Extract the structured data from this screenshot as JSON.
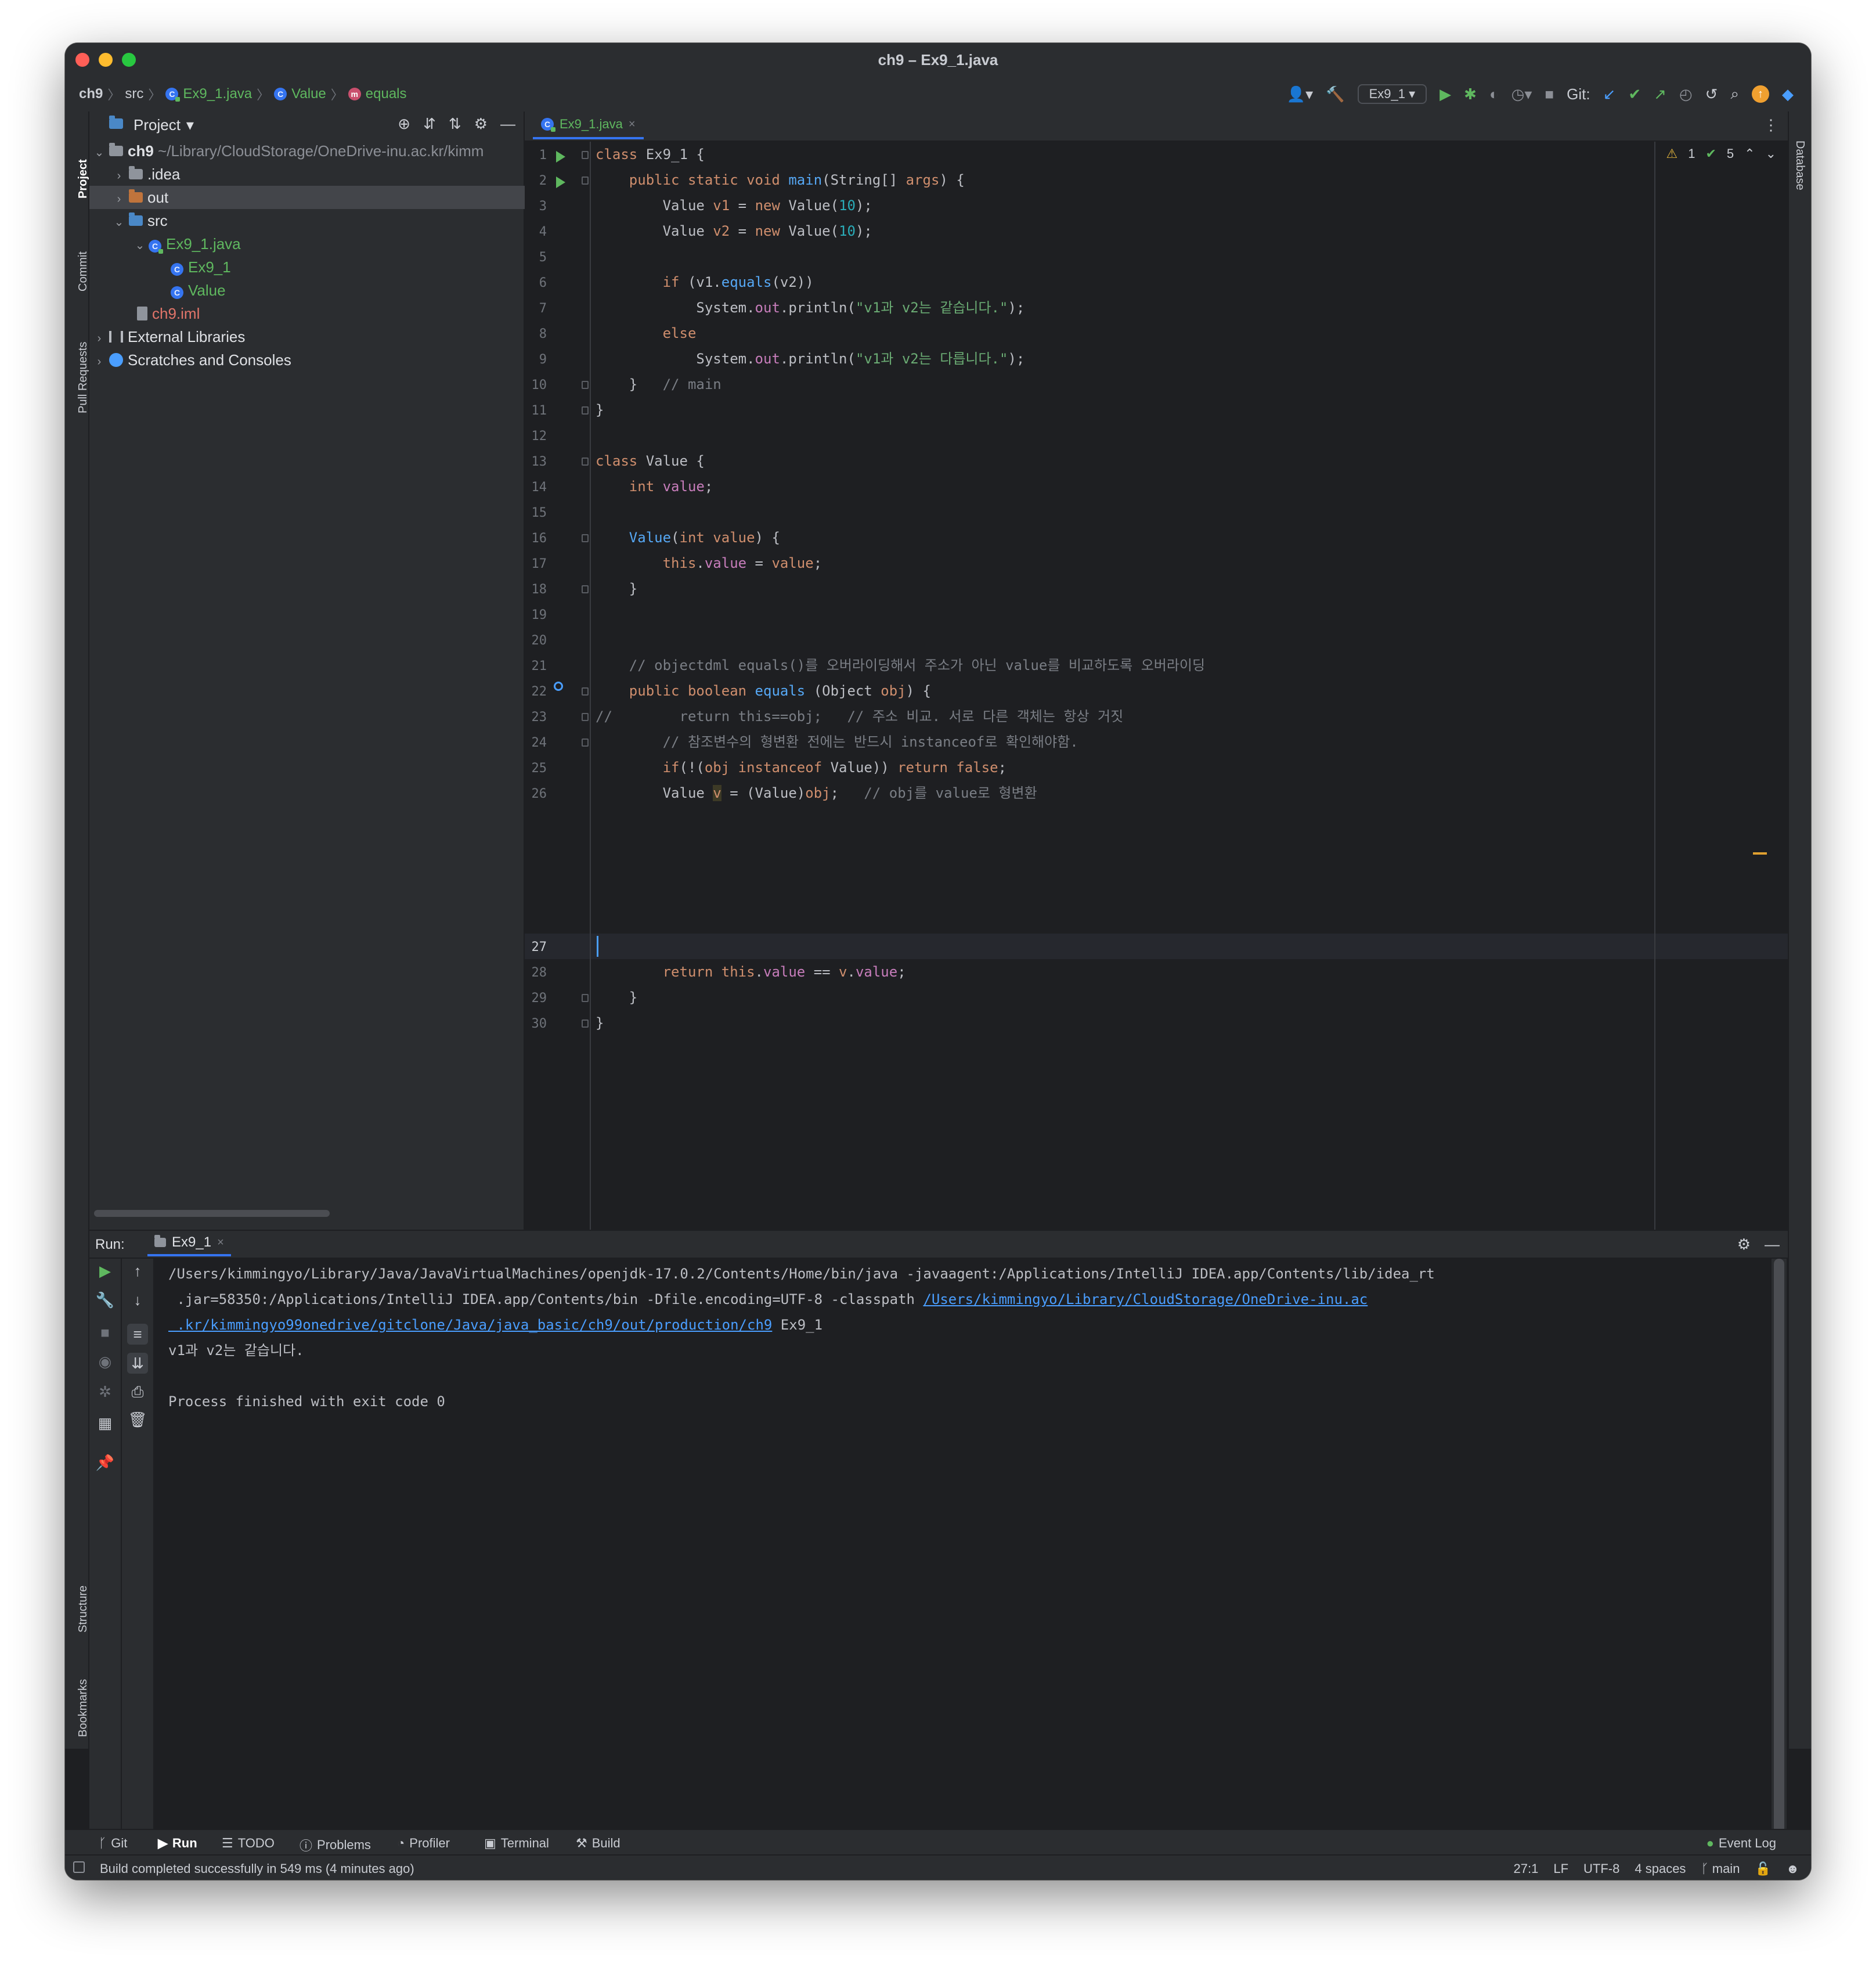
{
  "window": {
    "title": "ch9 – Ex9_1.java"
  },
  "navbar": {
    "crumbs": [
      "ch9",
      "src",
      "Ex9_1.java",
      "Value",
      "equals"
    ],
    "run_config": "Ex9_1",
    "git_label": "Git:"
  },
  "left_stripe": {
    "project": "Project",
    "commit": "Commit",
    "pull_requests": "Pull Requests",
    "structure": "Structure",
    "bookmarks": "Bookmarks"
  },
  "right_stripe": {
    "database": "Database"
  },
  "project": {
    "title": "Project",
    "root_name": "ch9",
    "root_path": "~/Library/CloudStorage/OneDrive-inu.ac.kr/kimm",
    "idea": ".idea",
    "out": "out",
    "src": "src",
    "java_file": "Ex9_1.java",
    "class1": "Ex9_1",
    "class2": "Value",
    "iml": "ch9.iml",
    "ext_libs": "External Libraries",
    "scratches": "Scratches and Consoles"
  },
  "editor": {
    "tab": "Ex9_1.java",
    "inspections": {
      "warnings": "1",
      "ok": "5"
    },
    "line_numbers": [
      "1",
      "2",
      "3",
      "4",
      "5",
      "6",
      "7",
      "8",
      "9",
      "10",
      "11",
      "12",
      "13",
      "14",
      "15",
      "16",
      "17",
      "18",
      "19",
      "20",
      "21",
      "22",
      "23",
      "24",
      "25",
      "26",
      "27",
      "28",
      "29",
      "30"
    ],
    "code": {
      "l1": {
        "a": "class",
        "b": " Ex9_1 {"
      },
      "l2": {
        "a": "    public static void ",
        "b": "main",
        "c": "(String[] ",
        "d": "args",
        "e": ") {"
      },
      "l3": {
        "a": "        Value ",
        "b": "v1",
        "c": " = ",
        "d": "new ",
        "e": "Value(",
        "f": "10",
        "g": ");"
      },
      "l4": {
        "a": "        Value ",
        "b": "v2",
        "c": " = ",
        "d": "new ",
        "e": "Value(",
        "f": "10",
        "g": ");"
      },
      "l6": {
        "a": "        ",
        "b": "if",
        "c": " (v1.",
        "d": "equals",
        "e": "(v2))"
      },
      "l7": {
        "a": "            System.",
        "b": "out",
        "c": ".println(",
        "d": "\"v1과 v2는 같습니다.\"",
        "e": ");"
      },
      "l8": {
        "a": "        ",
        "b": "else"
      },
      "l9": {
        "a": "            System.",
        "b": "out",
        "c": ".println(",
        "d": "\"v1과 v2는 다릅니다.\"",
        "e": ");"
      },
      "l10": {
        "a": "    }   ",
        "b": "// main"
      },
      "l11": {
        "a": "}"
      },
      "l13": {
        "a": "class",
        "b": " Value {"
      },
      "l14": {
        "a": "    ",
        "b": "int ",
        "c": "value",
        "d": ";"
      },
      "l16": {
        "a": "    ",
        "b": "Value",
        "c": "(",
        "d": "int ",
        "e": "value",
        "f": ") {"
      },
      "l17": {
        "a": "        ",
        "b": "this",
        "c": ".",
        "d": "value",
        "e": " = ",
        "f": "value",
        "g": ";"
      },
      "l18": {
        "a": "    }"
      },
      "l20": {
        "a": "    // objectdml equals()를 오버라이딩해서 주소가 아닌 value를 비교하도록 오버라이딩"
      },
      "l21": {
        "a": "    ",
        "b": "public boolean ",
        "c": "equals",
        "d": " (Object ",
        "e": "obj",
        "f": ") {"
      },
      "l22": {
        "a": "//        return this==obj;   // 주소 비교. 서로 다른 객체는 항상 거짓"
      },
      "l23": {
        "a": "        // 참조변수의 형변환 전에는 반드시 instanceof로 확인해야함."
      },
      "l24": {
        "a": "        ",
        "b": "if",
        "c": "(!(",
        "d": "obj ",
        "e": "instanceof ",
        "f": "Value)) ",
        "g": "return false",
        "h": ";"
      },
      "l26": {
        "a": "        Value ",
        "b": "v",
        "c": " = (Value)",
        "d": "obj",
        "e": ";   ",
        "f": "// obj를 value로 형변환"
      },
      "l28": {
        "a": "        ",
        "b": "return this",
        "c": ".",
        "d": "value",
        "e": " == ",
        "f": "v",
        "g": ".",
        "h": "value",
        "i": ";"
      },
      "l29": {
        "a": "    }"
      },
      "l30": {
        "a": "}"
      }
    }
  },
  "run": {
    "label": "Run:",
    "tab": "Ex9_1",
    "console": {
      "l1": "/Users/kimmingyo/Library/Java/JavaVirtualMachines/openjdk-17.0.2/Contents/Home/bin/java -javaagent:/Applications/IntelliJ IDEA.app/Contents/lib/idea_rt",
      "l2a": " .jar=58350:/Applications/IntelliJ IDEA.app/Contents/bin -Dfile.encoding=UTF-8 -classpath ",
      "l2b": "/Users/kimmingyo/Library/CloudStorage/OneDrive-inu.ac",
      "l3a": " .kr/kimmingyo99onedrive/gitclone/Java/java_basic/ch9/out/production/ch9",
      "l3b": " Ex9_1",
      "l4": "v1과 v2는 같습니다.",
      "l6": "Process finished with exit code 0"
    }
  },
  "tool_windows": [
    "Git",
    "Run",
    "TODO",
    "Problems",
    "Profiler",
    "Terminal",
    "Build"
  ],
  "event_log": "Event Log",
  "status": {
    "message": "Build completed successfully in 549 ms (4 minutes ago)",
    "position": "27:1",
    "line_sep": "LF",
    "encoding": "UTF-8",
    "indent": "4 spaces",
    "branch": "main"
  },
  "colors": {
    "accent": "#3574f0",
    "keyword": "#cf8e6d",
    "number": "#2aacb8",
    "string": "#6aab73",
    "run_green": "#5fb85f"
  }
}
